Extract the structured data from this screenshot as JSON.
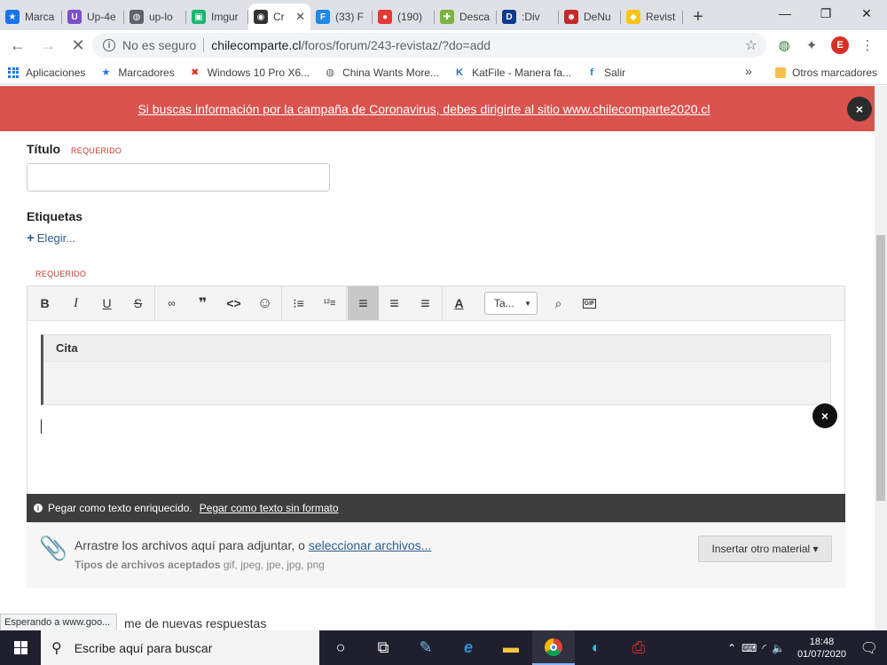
{
  "browser": {
    "tabs": [
      {
        "label": "Marca",
        "icon": "star-icon",
        "color": "#1a73e8",
        "glyph": "★"
      },
      {
        "label": "Up-4e",
        "icon": "upload-icon",
        "color": "#7b4fc9",
        "glyph": "U"
      },
      {
        "label": "up-lo",
        "icon": "globe-icon",
        "color": "#5f6368",
        "glyph": "◍"
      },
      {
        "label": "Imgur",
        "icon": "imgur-icon",
        "color": "#1bb76e",
        "glyph": "▣"
      },
      {
        "label": "Cr",
        "icon": "site-icon",
        "color": "#333333",
        "glyph": "◉",
        "active": true
      },
      {
        "label": "(33) F",
        "icon": "f-icon",
        "color": "#1e88e5",
        "glyph": "F"
      },
      {
        "label": "(190)",
        "icon": "red-icon",
        "color": "#e53935",
        "glyph": "●"
      },
      {
        "label": "Desca",
        "icon": "plus-green-icon",
        "color": "#7cb342",
        "glyph": "✚"
      },
      {
        "label": ":Div",
        "icon": "dl-icon",
        "color": "#0d3b8c",
        "glyph": "D"
      },
      {
        "label": "DeNu",
        "icon": "devil-icon",
        "color": "#c62828",
        "glyph": "☻"
      },
      {
        "label": "Revist",
        "icon": "yellow-icon",
        "color": "#f9c513",
        "glyph": "◆"
      }
    ],
    "new_tab": "+",
    "window_controls": {
      "minimize": "—",
      "restore": "❐",
      "close": "✕"
    },
    "nav": {
      "back": "←",
      "forward": "→",
      "stop": "✕"
    },
    "address": {
      "security": "No es seguro",
      "host": "chilecomparte.cl",
      "path": "/foros/forum/243-revistaz/?do=add"
    },
    "profile_initial": "E",
    "bookmarks": [
      {
        "label": "Aplicaciones",
        "icon": "apps-icon"
      },
      {
        "label": "Marcadores",
        "icon": "star-icon",
        "glyph": "★",
        "color": "#1a73e8"
      },
      {
        "label": "Windows 10 Pro X6...",
        "icon": "windows-x-icon",
        "glyph": "✖",
        "color": "#d93025"
      },
      {
        "label": "",
        "icon": "globe-icon",
        "glyph": "◍",
        "color": "#5f6368"
      },
      {
        "label": "China Wants More...",
        "icon": "globe-icon",
        "glyph": "◍",
        "color": "#5f6368"
      },
      {
        "label": "KatFile - Manera fa...",
        "icon": "katfile-icon",
        "glyph": "K",
        "color": "#2b6cb0"
      },
      {
        "label": "Salir",
        "icon": "facebook-icon",
        "glyph": "f",
        "color": "#1877f2"
      }
    ],
    "bookmarks_more": "»",
    "other_bookmarks": "Otros marcadores"
  },
  "page": {
    "banner": "Si buscas información por la campaña de Coronavirus, debes dirigirte al sitio www.chilecomparte2020.cl",
    "banner_close": "×",
    "title_label": "Título",
    "required": "REQUERIDO",
    "tags_label": "Etiquetas",
    "choose": "Elegir...",
    "editor": {
      "toolbar": {
        "bold": "B",
        "italic": "I",
        "underline": "U",
        "strike": "S",
        "link": "🔗",
        "quote": "❞❞",
        "code": "<>",
        "emoji": "☺",
        "bullets": "☰",
        "numbered": "☷",
        "align_left": "≡",
        "align_center": "≡",
        "align_right": "≡",
        "color": "A",
        "size": "Ta...",
        "preview": "⌕",
        "gif": "GIF"
      },
      "quote_label": "Cita",
      "paste_text": "Pegar como texto enriquecido.",
      "paste_link": "Pegar como texto sin formato",
      "paste_close": "×",
      "attach_text": "Arrastre los archivos aquí para adjuntar, o ",
      "attach_link": "seleccionar archivos...",
      "types_label": "Tipos de archivos aceptados",
      "types_value": "gif, jpeg, jpe, jpg, png",
      "insert_button": "Insertar otro material ▾"
    },
    "notify_text": "me de nuevas respuestas",
    "status": "Esperando a www.goo..."
  },
  "taskbar": {
    "search_placeholder": "Escribe aquí para buscar",
    "time": "18:48",
    "date": "01/07/2020"
  }
}
